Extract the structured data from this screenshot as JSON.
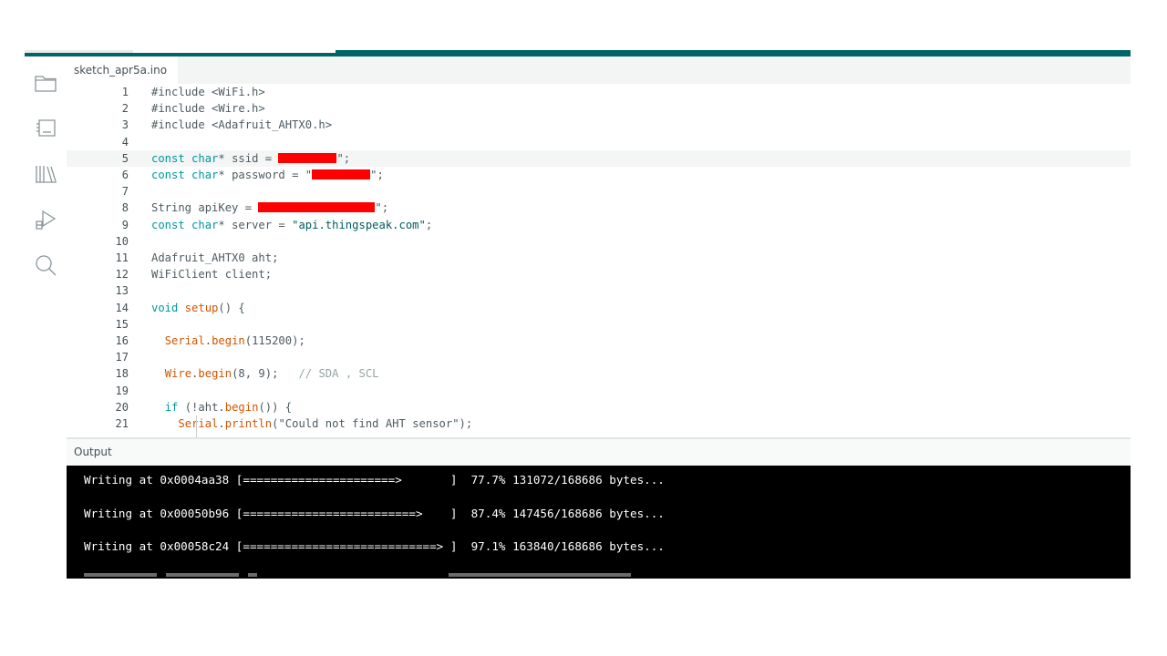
{
  "app": {
    "accent_color": "#006468",
    "tab_title": "sketch_apr5a.ino"
  },
  "sidebar": {
    "items": [
      {
        "name": "sketchbook",
        "icon": "folder-icon"
      },
      {
        "name": "boards-manager",
        "icon": "board-icon"
      },
      {
        "name": "library-manager",
        "icon": "library-icon"
      },
      {
        "name": "debug",
        "icon": "debug-icon"
      },
      {
        "name": "search",
        "icon": "search-icon"
      }
    ]
  },
  "editor": {
    "active_line": 5,
    "lines": [
      {
        "n": "1",
        "tokens": [
          {
            "t": "#include <WiFi.h>",
            "c": ""
          }
        ]
      },
      {
        "n": "2",
        "tokens": [
          {
            "t": "#include <Wire.h>",
            "c": ""
          }
        ]
      },
      {
        "n": "3",
        "tokens": [
          {
            "t": "#include <Adafruit_AHTX0.h>",
            "c": ""
          }
        ]
      },
      {
        "n": "4",
        "tokens": []
      },
      {
        "n": "5",
        "tokens": [
          {
            "t": "const",
            "c": "kw"
          },
          {
            "t": " ",
            "c": ""
          },
          {
            "t": "char",
            "c": "type"
          },
          {
            "t": "* ssid = ",
            "c": ""
          },
          {
            "r": 64
          },
          {
            "t": "\";",
            "c": ""
          }
        ]
      },
      {
        "n": "6",
        "tokens": [
          {
            "t": "const",
            "c": "kw"
          },
          {
            "t": " ",
            "c": ""
          },
          {
            "t": "char",
            "c": "type"
          },
          {
            "t": "* password = \"",
            "c": ""
          },
          {
            "r": 64
          },
          {
            "t": "\";",
            "c": ""
          }
        ]
      },
      {
        "n": "7",
        "tokens": []
      },
      {
        "n": "8",
        "tokens": [
          {
            "t": "String apiKey = ",
            "c": ""
          },
          {
            "r": 128
          },
          {
            "t": "\";",
            "c": ""
          }
        ]
      },
      {
        "n": "9",
        "tokens": [
          {
            "t": "const",
            "c": "kw"
          },
          {
            "t": " ",
            "c": ""
          },
          {
            "t": "char",
            "c": "type"
          },
          {
            "t": "* server = ",
            "c": ""
          },
          {
            "t": "\"api.thingspeak.com\"",
            "c": "str"
          },
          {
            "t": ";",
            "c": ""
          }
        ]
      },
      {
        "n": "10",
        "tokens": []
      },
      {
        "n": "11",
        "tokens": [
          {
            "t": "Adafruit_AHTX0 aht;",
            "c": ""
          }
        ]
      },
      {
        "n": "12",
        "tokens": [
          {
            "t": "WiFiClient client;",
            "c": ""
          }
        ]
      },
      {
        "n": "13",
        "tokens": []
      },
      {
        "n": "14",
        "tokens": [
          {
            "t": "void",
            "c": "kw"
          },
          {
            "t": " ",
            "c": ""
          },
          {
            "t": "setup",
            "c": "fn"
          },
          {
            "t": "() {",
            "c": ""
          }
        ]
      },
      {
        "n": "15",
        "tokens": []
      },
      {
        "n": "16",
        "tokens": [
          {
            "t": "  ",
            "c": ""
          },
          {
            "t": "Serial",
            "c": "fn"
          },
          {
            "t": ".",
            "c": ""
          },
          {
            "t": "begin",
            "c": "fn"
          },
          {
            "t": "(115200);",
            "c": ""
          }
        ]
      },
      {
        "n": "17",
        "tokens": []
      },
      {
        "n": "18",
        "tokens": [
          {
            "t": "  ",
            "c": ""
          },
          {
            "t": "Wire",
            "c": "fn"
          },
          {
            "t": ".",
            "c": ""
          },
          {
            "t": "begin",
            "c": "fn"
          },
          {
            "t": "(8, 9);   ",
            "c": ""
          },
          {
            "t": "// SDA , SCL",
            "c": "cmt"
          }
        ]
      },
      {
        "n": "19",
        "tokens": []
      },
      {
        "n": "20",
        "tokens": [
          {
            "t": "  ",
            "c": ""
          },
          {
            "t": "if",
            "c": "kw"
          },
          {
            "t": " (!",
            "c": ""
          },
          {
            "t": "aht",
            "c": ""
          },
          {
            "t": ".",
            "c": ""
          },
          {
            "t": "begin",
            "c": "fn"
          },
          {
            "t": "()) {",
            "c": ""
          }
        ]
      },
      {
        "n": "21",
        "tokens": [
          {
            "t": "    ",
            "c": ""
          },
          {
            "t": "Serial",
            "c": "fn"
          },
          {
            "t": ".",
            "c": ""
          },
          {
            "t": "println",
            "c": "fn"
          },
          {
            "t": "(\"Could not find AHT sensor\");",
            "c": ""
          }
        ]
      }
    ]
  },
  "output": {
    "title": "Output",
    "lines": [
      "Writing at 0x0004aa38 [======================>       ]  77.7% 131072/168686 bytes...",
      "Writing at 0x00050b96 [=========================>    ]  87.4% 147456/168686 bytes...",
      "Writing at 0x00058c24 [============================> ]  97.1% 163840/168686 bytes..."
    ]
  }
}
